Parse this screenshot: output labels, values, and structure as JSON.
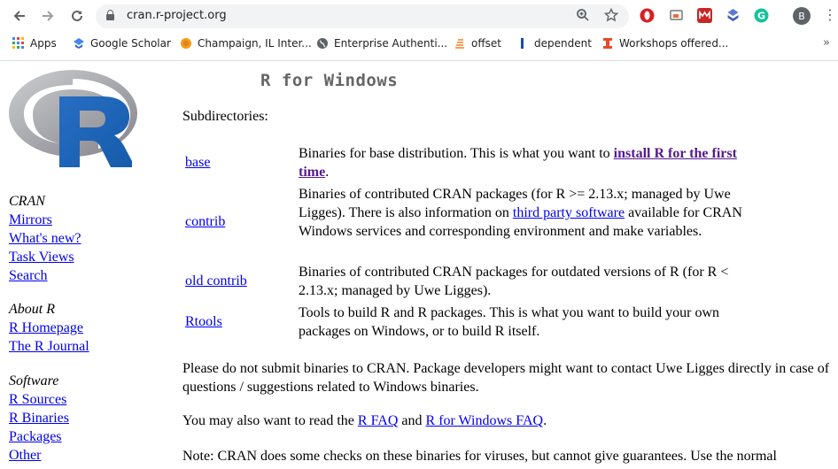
{
  "browser": {
    "url": "cran.r-project.org",
    "bookmarks": [
      {
        "label": "Apps"
      },
      {
        "label": "Google Scholar"
      },
      {
        "label": "Champaign, IL Inter..."
      },
      {
        "label": "Enterprise Authenti..."
      },
      {
        "label": "offset"
      },
      {
        "label": "dependent"
      },
      {
        "label": "Workshops offered..."
      }
    ],
    "profile_initial": "B",
    "grammarly_initial": "G"
  },
  "sidebar": {
    "cran_heading": "CRAN",
    "cran_links": [
      "Mirrors",
      "What's new?",
      "Task Views",
      "Search"
    ],
    "about_heading": "About R",
    "about_links": [
      "R Homepage",
      "The R Journal"
    ],
    "software_heading": "Software",
    "software_links": [
      "R Sources",
      "R Binaries",
      "Packages",
      "Other"
    ]
  },
  "main": {
    "title": "R for Windows",
    "subdirectories_label": "Subdirectories:",
    "rows": [
      {
        "link": "base",
        "desc_pre": "Binaries for base distribution. This is what you want to ",
        "desc_link": "install R for the first time",
        "desc_post": "."
      },
      {
        "link": "contrib",
        "desc_pre": "Binaries of contributed CRAN packages (for R >= 2.13.x; managed by Uwe Ligges). There is also information on ",
        "desc_link": "third party software",
        "desc_post": " available for CRAN Windows services and corresponding environment and make variables."
      },
      {
        "link": "old contrib",
        "desc": "Binaries of contributed CRAN packages for outdated versions of R (for R < 2.13.x; managed by Uwe Ligges)."
      },
      {
        "link": "Rtools",
        "desc": "Tools to build R and R packages. This is what you want to build your own packages on Windows, or to build R itself."
      }
    ],
    "para1": "Please do not submit binaries to CRAN. Package developers might want to contact Uwe Ligges directly in case of questions / suggestions related to Windows binaries.",
    "para2_pre": "You may also want to read the ",
    "para2_link1": "R FAQ",
    "para2_mid": " and ",
    "para2_link2": "R for Windows FAQ",
    "para2_post": ".",
    "para3": "Note: CRAN does some checks on these binaries for viruses, but cannot give guarantees. Use the normal"
  }
}
